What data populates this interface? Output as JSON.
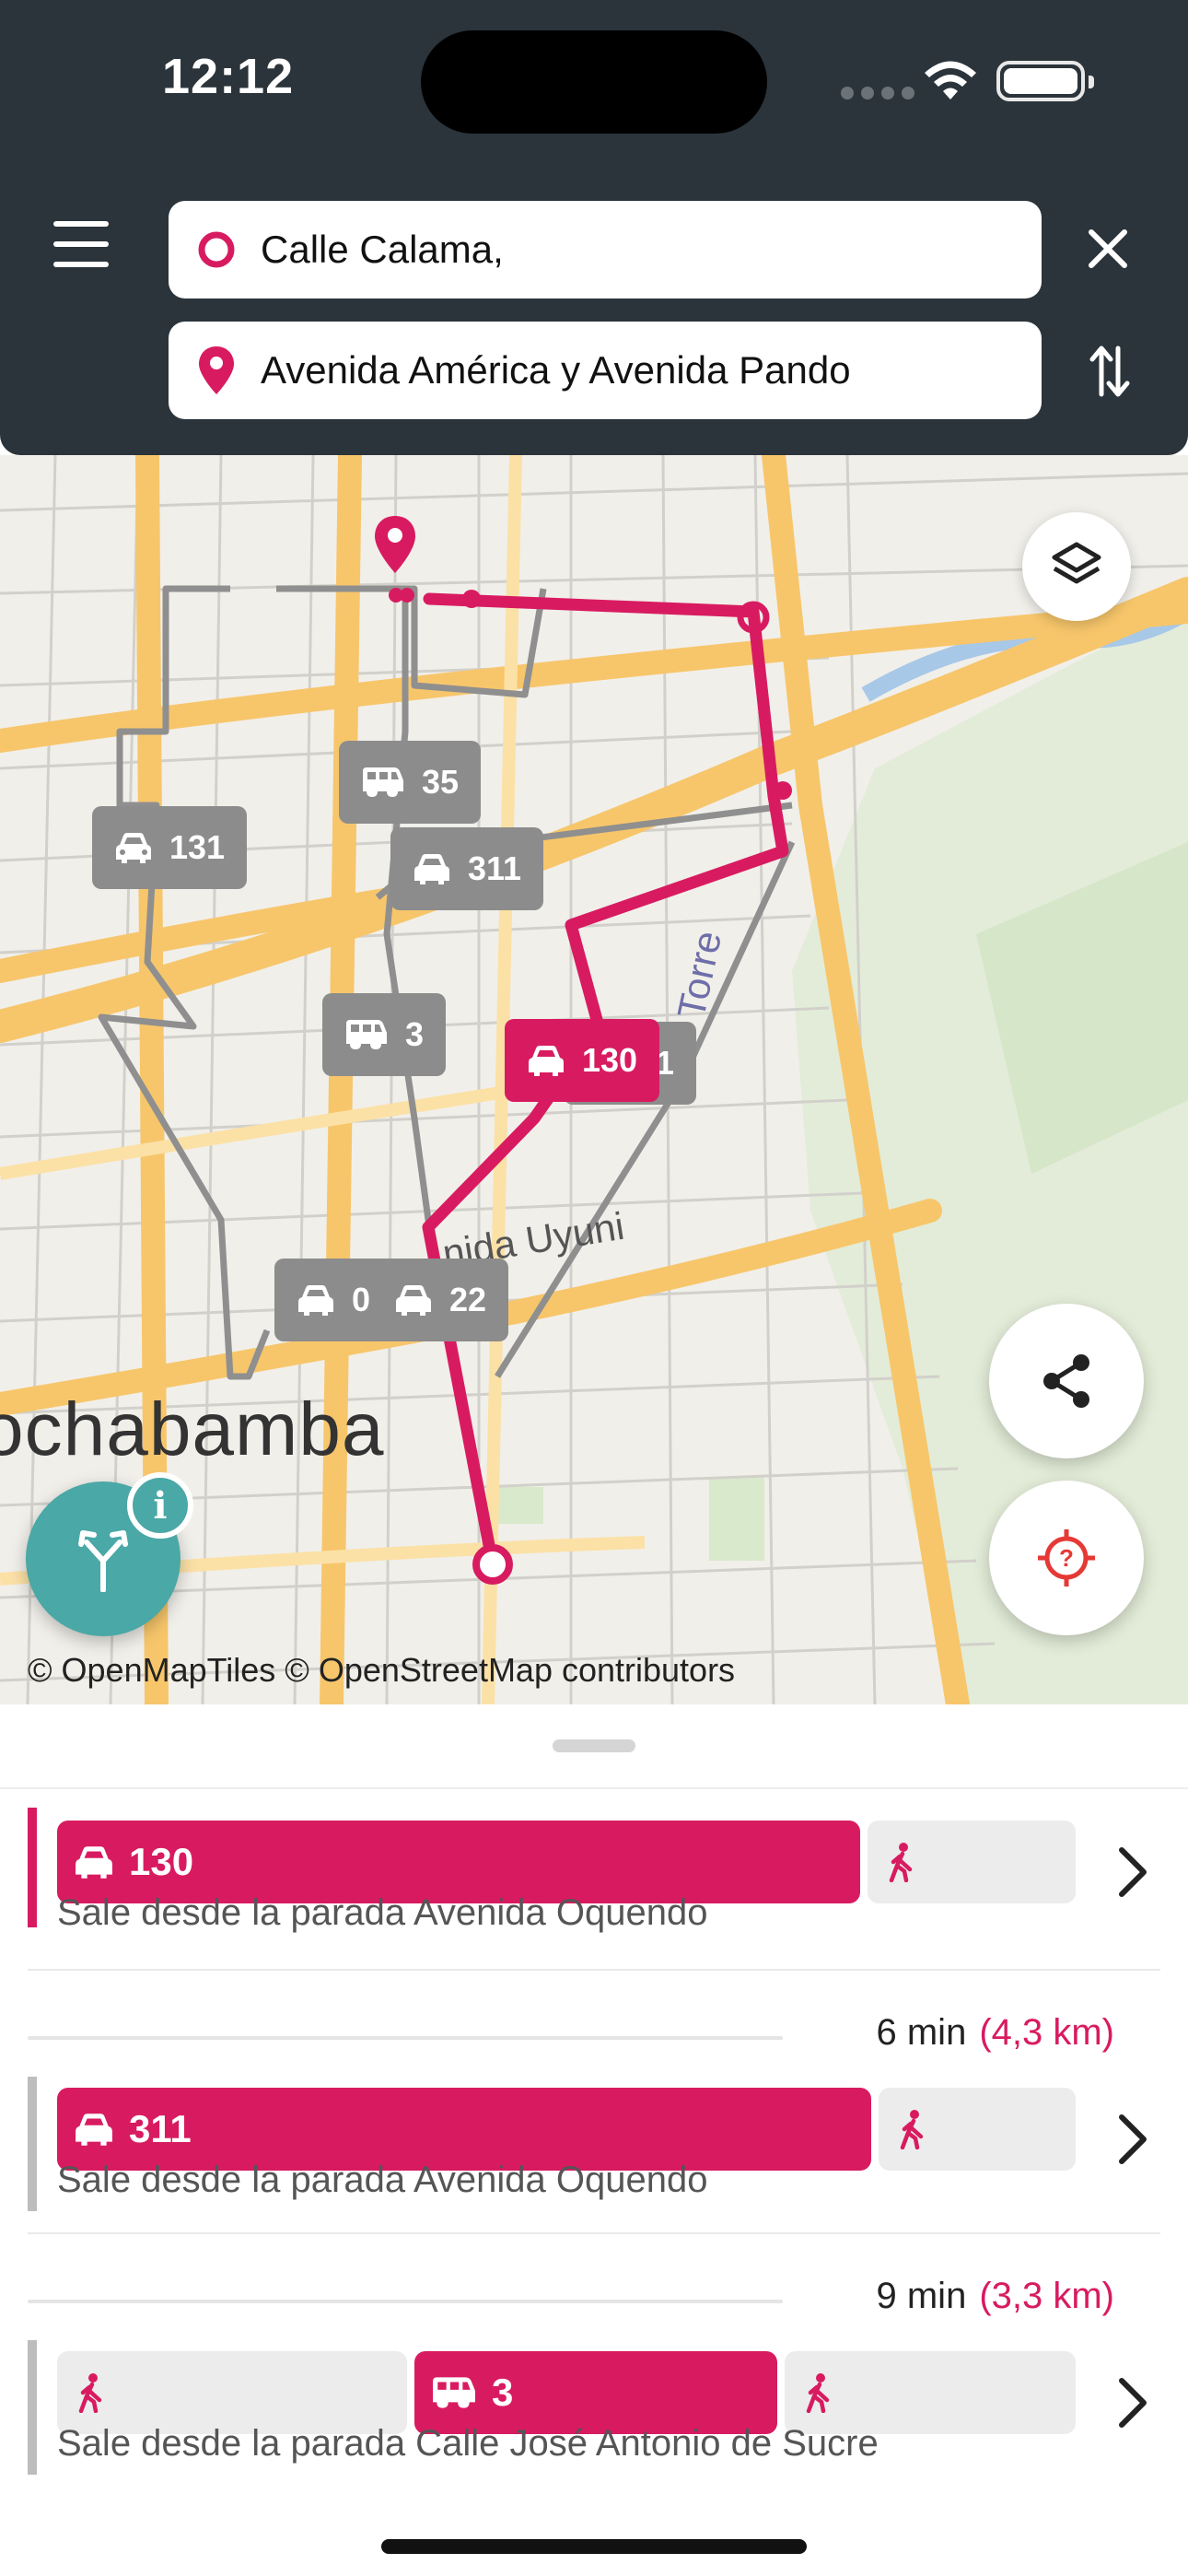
{
  "status_bar": {
    "time": "12:12"
  },
  "search": {
    "origin_value": "Calle Calama,",
    "destination_value": "Avenida América y Avenida Pando"
  },
  "map": {
    "road_label": "nida Uyuni",
    "road_label_2": "Torre",
    "city_label": "ochabamba",
    "attribution": "© OpenMapTiles © OpenStreetMap contributors",
    "badges": [
      {
        "icon": "taxi-icon",
        "label": "131"
      },
      {
        "icon": "bus-icon",
        "label": "35"
      },
      {
        "icon": "taxi-icon",
        "label": "311"
      },
      {
        "icon": "bus-icon",
        "label": "3"
      },
      {
        "icon": "taxi-icon",
        "label": "130"
      },
      {
        "icon": "taxi-icon",
        "label": "31"
      },
      {
        "icon": "taxi-icon",
        "label": "01"
      },
      {
        "icon": "taxi-icon",
        "label": "22"
      }
    ],
    "info_badge": "i"
  },
  "routes": [
    {
      "line": "130",
      "line_icon": "taxi-icon",
      "description": "Sale desde la parada Avenida Oquendo"
    },
    {
      "time": "6 min",
      "distance": "(4,3 km)",
      "line": "311",
      "line_icon": "taxi-icon",
      "description": "Sale desde la parada Avenida Oquendo"
    },
    {
      "time": "9 min",
      "distance": "(3,3 km)",
      "line": "3",
      "line_icon": "bus-icon",
      "description": "Sale desde la parada Calle José Antonio de Sucre"
    }
  ],
  "colors": {
    "accent": "#d81b60",
    "header": "#2b343a",
    "teal": "#4aa8a6",
    "badge_grey": "#8c8c8c"
  }
}
